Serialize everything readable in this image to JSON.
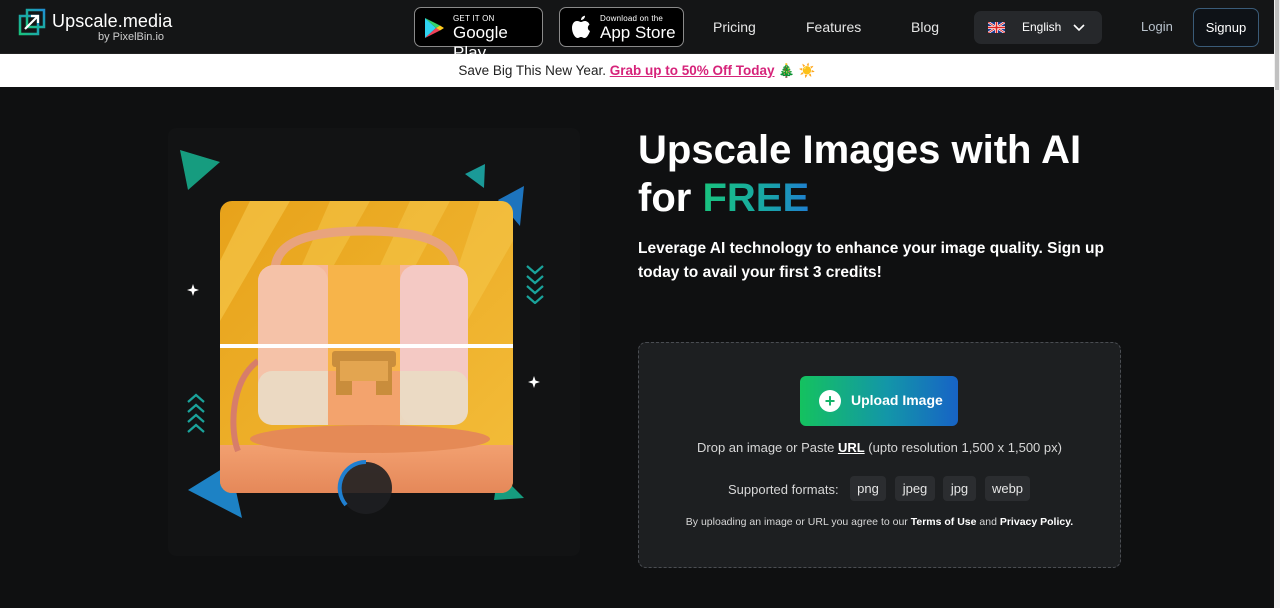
{
  "nav": {
    "brand_name": "Upscale.media",
    "brand_sub": "by PixelBin.io",
    "google_play": {
      "small": "GET IT ON",
      "big": "Google Play"
    },
    "app_store": {
      "small": "Download on the",
      "big": "App Store"
    },
    "links": [
      "Pricing",
      "Features",
      "Blog"
    ],
    "language": "English",
    "login": "Login",
    "signup": "Signup"
  },
  "promo": {
    "text": "Save Big This New Year.",
    "link": "Grab up to 50% Off Today",
    "emoji": "🎄 ☀️"
  },
  "hero": {
    "title_line1": "Upscale Images with AI",
    "title_for": "for",
    "title_free": "FREE",
    "subtitle": "Leverage AI technology to enhance your image quality. Sign up today to avail your first 3 credits!"
  },
  "upload": {
    "button_label": "Upload Image",
    "drop_text": "Drop an image or Paste",
    "drop_url": "URL",
    "drop_resolution": "(upto resolution 1,500 x 1,500 px)",
    "formats_label": "Supported formats:",
    "formats": [
      "png",
      "jpeg",
      "jpg",
      "webp"
    ],
    "terms_prefix": "By uploading an image or URL you agree to our",
    "terms_link": "Terms of Use",
    "terms_and": "and",
    "privacy_link": "Privacy Policy."
  },
  "colors": {
    "accent_green": "#19c37d",
    "accent_blue": "#1f7fd0",
    "promo_link": "#d6237a",
    "background": "#0f1011"
  }
}
